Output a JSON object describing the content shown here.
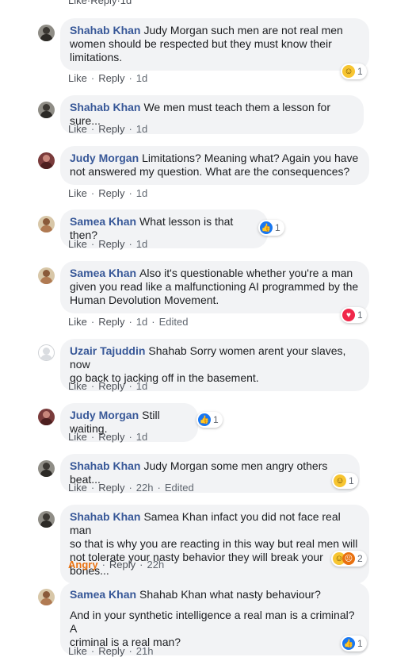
{
  "top_actions": {
    "like": "Like",
    "reply": "Reply",
    "time": "1d"
  },
  "comments": [
    {
      "author": "Shahab Khan",
      "avatar": "person-icon",
      "lines": [
        "Judy Morgan such men are not real men",
        "women should be respected but they must know their",
        "limitations."
      ],
      "actions": {
        "like": "Like",
        "reply": "Reply",
        "time": "1d"
      },
      "reaction": {
        "icon": "haha",
        "count": "1"
      }
    },
    {
      "author": "Shahab Khan",
      "avatar": "person-icon",
      "lines": [
        "We men must teach them a lesson for sure..."
      ],
      "actions": {
        "like": "Like",
        "reply": "Reply",
        "time": "1d"
      }
    },
    {
      "author": "Judy Morgan",
      "avatar": "person-icon",
      "lines": [
        "Limitations? Meaning what? Again you have",
        "not answered my question. What are the consequences?"
      ],
      "actions": {
        "like": "Like",
        "reply": "Reply",
        "time": "1d"
      }
    },
    {
      "author": "Samea Khan",
      "avatar": "person-icon",
      "lines": [
        "What lesson is that then?"
      ],
      "actions": {
        "like": "Like",
        "reply": "Reply",
        "time": "1d"
      },
      "reaction": {
        "icon": "like",
        "count": "1"
      }
    },
    {
      "author": "Samea Khan",
      "avatar": "person-icon",
      "lines": [
        "Also it's questionable whether you're a man",
        "given you read like a malfunctioning AI programmed by the",
        "Human Devolution Movement."
      ],
      "actions": {
        "like": "Like",
        "reply": "Reply",
        "time": "1d",
        "edited": "Edited"
      },
      "reaction": {
        "icon": "love",
        "count": "1"
      }
    },
    {
      "author": "Uzair Tajuddin",
      "avatar": "person-icon",
      "lines": [
        "Shahab Sorry women arent your slaves, now",
        "go back to jacking off in the basement."
      ],
      "actions": {
        "like": "Like",
        "reply": "Reply",
        "time": "1d"
      }
    },
    {
      "author": "Judy Morgan",
      "avatar": "person-icon",
      "lines": [
        "Still waiting."
      ],
      "actions": {
        "like": "Like",
        "reply": "Reply",
        "time": "1d"
      },
      "reaction": {
        "icon": "like",
        "count": "1"
      }
    },
    {
      "author": "Shahab Khan",
      "avatar": "person-icon",
      "lines": [
        "Judy Morgan some men angry others beat..."
      ],
      "actions": {
        "like": "Like",
        "reply": "Reply",
        "time": "22h",
        "edited": "Edited"
      },
      "reaction": {
        "icon": "haha",
        "count": "1"
      }
    },
    {
      "author": "Shahab Khan",
      "avatar": "person-icon",
      "lines": [
        "Samea Khan infact you did not face real man",
        "so that is why you are reacting in this way but real men will",
        "not tolerate your nasty behavior they will break your bones..."
      ],
      "actions": {
        "like": "Angry",
        "reply": "Reply",
        "time": "22h"
      },
      "reaction": {
        "icon": "haha+angry",
        "count": "2"
      }
    },
    {
      "author": "Samea Khan",
      "avatar": "person-icon",
      "lines": [
        "Shahab Khan what nasty behaviour?"
      ],
      "paragraph2": [
        "And in your synthetic intelligence a real man is a criminal? A",
        "criminal is a real man?"
      ],
      "actions": {
        "like": "Like",
        "reply": "Reply",
        "time": "21h"
      },
      "reaction": {
        "icon": "like",
        "count": "1"
      }
    }
  ],
  "colors": {
    "name": "#385898",
    "bubble": "#f2f3f5",
    "meta": "#606770",
    "angry": "#e9710f",
    "like": "#1877f2",
    "love": "#f0284a",
    "haha": "#f7c531"
  }
}
